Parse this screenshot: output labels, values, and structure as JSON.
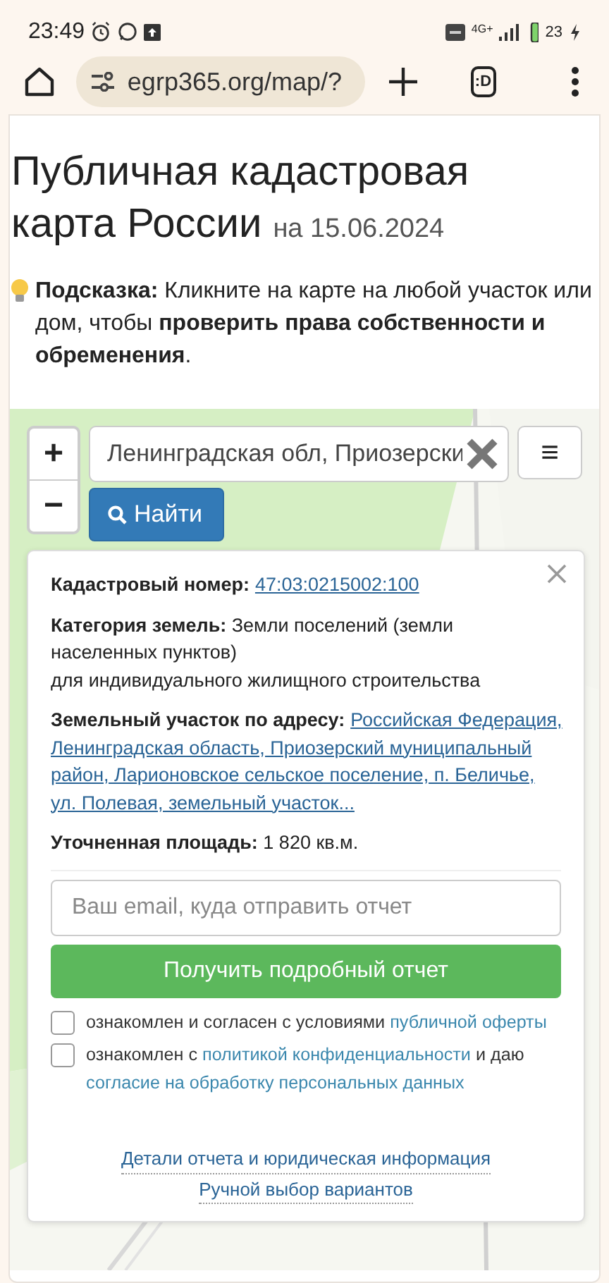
{
  "status_bar": {
    "time": "23:49",
    "network": "4G+",
    "battery": "23"
  },
  "browser": {
    "url": "egrp365.org/map/?",
    "tabs_label": ":D"
  },
  "page": {
    "title_lines": [
      "Публичная кадастровая",
      "карта России"
    ],
    "date": "на 15.06.2024",
    "hint": "**Подсказка:** Кликните на карте на любой участок или дом, чтобы **проверить права собственности и обременения**."
  },
  "map": {
    "search_value": "Ленинградская обл, Приозерски",
    "search_button": "Найти",
    "zoom_in": "+",
    "zoom_out": "−",
    "menu": "≡",
    "kind": "picture"
  },
  "popup": {
    "fields": [
      {
        "kind": "link",
        "label": "Кадастровый номер:",
        "lines": [
          "47:03:0215002:100"
        ]
      },
      {
        "kind": "text",
        "text": "**Категория земель:** Земли поселений (земли населенных пунктов)",
        "extra": "для индивидуального жилищного строительства"
      },
      {
        "kind": "link",
        "label": "Земельный участок по адресу:",
        "lines": [
          "Российская Федерация,",
          "Ленинградская область, Приозерский муниципальный",
          "район, Ларионовское сельское поселение, п. Беличье,",
          "ул. Полевая, земельный участок..."
        ]
      },
      {
        "kind": "text",
        "text": "**Уточненная площадь:** 1 820 кв.м."
      }
    ],
    "email_placeholder": "Ваш email, куда отправить отчет",
    "submit": "Получить подробный отчет",
    "consents": [
      {
        "checked": false,
        "parts": [
          {
            "kind": "text",
            "text": "ознакомлен и согласен с условиями"
          },
          {
            "kind": "link",
            "text": "публичной оферты"
          }
        ]
      },
      {
        "checked": false,
        "parts": [
          {
            "kind": "text",
            "text": "ознакомлен с"
          },
          {
            "kind": "link",
            "text": "политикой конфиденциальности"
          },
          {
            "kind": "text",
            "text": "и даю"
          },
          {
            "kind": "link",
            "text": "согласие на обработку персональных данных"
          }
        ]
      }
    ],
    "footer_links": [
      "Детали отчета и юридическая информация",
      "Ручной выбор вариантов"
    ]
  }
}
